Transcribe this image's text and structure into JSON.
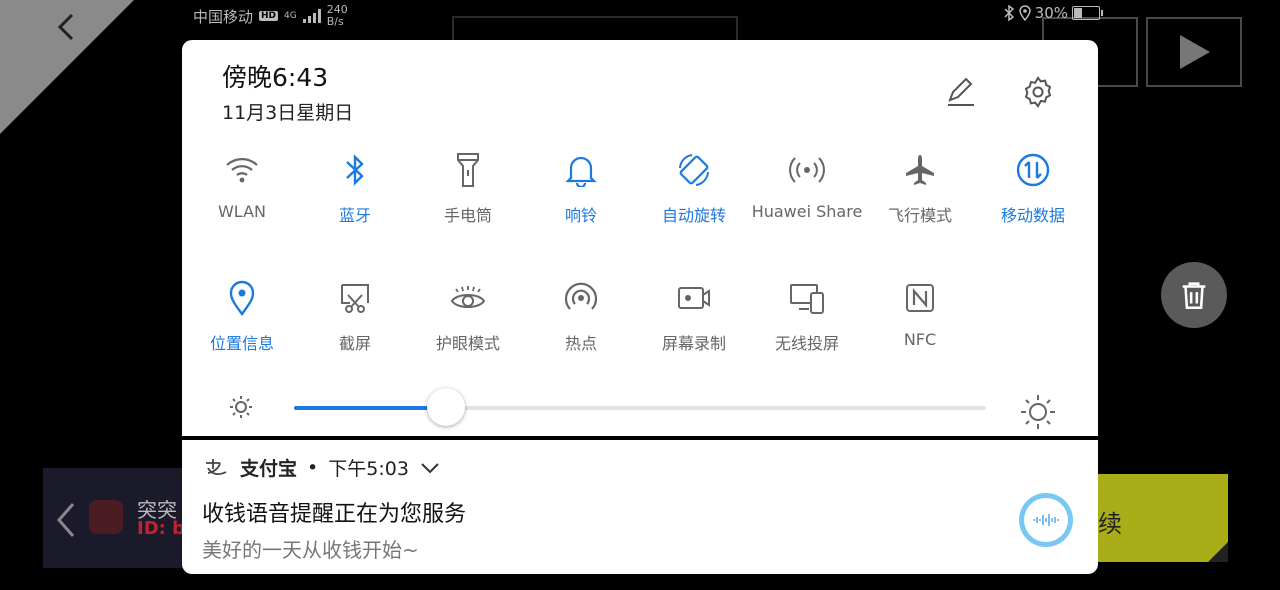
{
  "status_bar": {
    "carrier": "中国移动",
    "hd": "HD",
    "network": "4G",
    "speed_value": "240",
    "speed_unit": "B/s",
    "battery": "30%",
    "battery_level": 0.3
  },
  "header": {
    "time": "傍晚6:43",
    "date": "11月3日星期日"
  },
  "tiles": [
    {
      "label": "WLAN",
      "icon": "wifi-icon",
      "on": false
    },
    {
      "label": "蓝牙",
      "icon": "bluetooth-icon",
      "on": true
    },
    {
      "label": "手电筒",
      "icon": "flashlight-icon",
      "on": false
    },
    {
      "label": "响铃",
      "icon": "bell-icon",
      "on": true
    },
    {
      "label": "自动旋转",
      "icon": "auto-rotate-icon",
      "on": true
    },
    {
      "label": "Huawei Share",
      "icon": "huawei-share-icon",
      "on": false
    },
    {
      "label": "飞行模式",
      "icon": "airplane-icon",
      "on": false
    },
    {
      "label": "移动数据",
      "icon": "mobile-data-icon",
      "on": true
    },
    {
      "label": "位置信息",
      "icon": "location-icon",
      "on": true
    },
    {
      "label": "截屏",
      "icon": "screenshot-icon",
      "on": false
    },
    {
      "label": "护眼模式",
      "icon": "eye-comfort-icon",
      "on": false
    },
    {
      "label": "热点",
      "icon": "hotspot-icon",
      "on": false
    },
    {
      "label": "屏幕录制",
      "icon": "screen-record-icon",
      "on": false,
      "pressed": true
    },
    {
      "label": "无线投屏",
      "icon": "wireless-projection-icon",
      "on": false
    },
    {
      "label": "NFC",
      "icon": "nfc-icon",
      "on": false
    }
  ],
  "brightness": {
    "value": 0.22
  },
  "notification": {
    "app": "支付宝",
    "time": "下午5:03",
    "title": "收钱语音提醒正在为您服务",
    "body": "美好的一天从收钱开始~"
  },
  "background_app": {
    "left_card_name": "突突",
    "left_card_id": "ID: b",
    "right_card_text": "续"
  },
  "colors": {
    "accent": "#1a7ae0",
    "inactive_icon": "#666666"
  }
}
